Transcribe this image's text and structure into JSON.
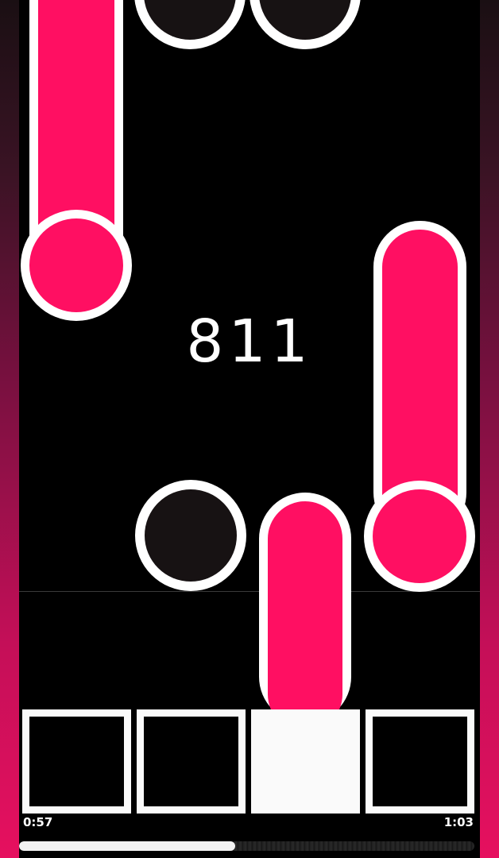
{
  "game": {
    "score": "811",
    "time_elapsed": "0:57",
    "time_total": "1:03",
    "progress": 0.475,
    "lanes": 4,
    "pressed_lane": 3
  },
  "colors": {
    "note_pink": "#ff0f62",
    "note_dark": "#171213",
    "outline": "#ffffff",
    "background": "#000000",
    "key_pressed": "#fafafa"
  },
  "keys": [
    {
      "lane": 1,
      "state": "idle"
    },
    {
      "lane": 2,
      "state": "idle"
    },
    {
      "lane": 3,
      "state": "pressed"
    },
    {
      "lane": 4,
      "state": "idle"
    }
  ]
}
